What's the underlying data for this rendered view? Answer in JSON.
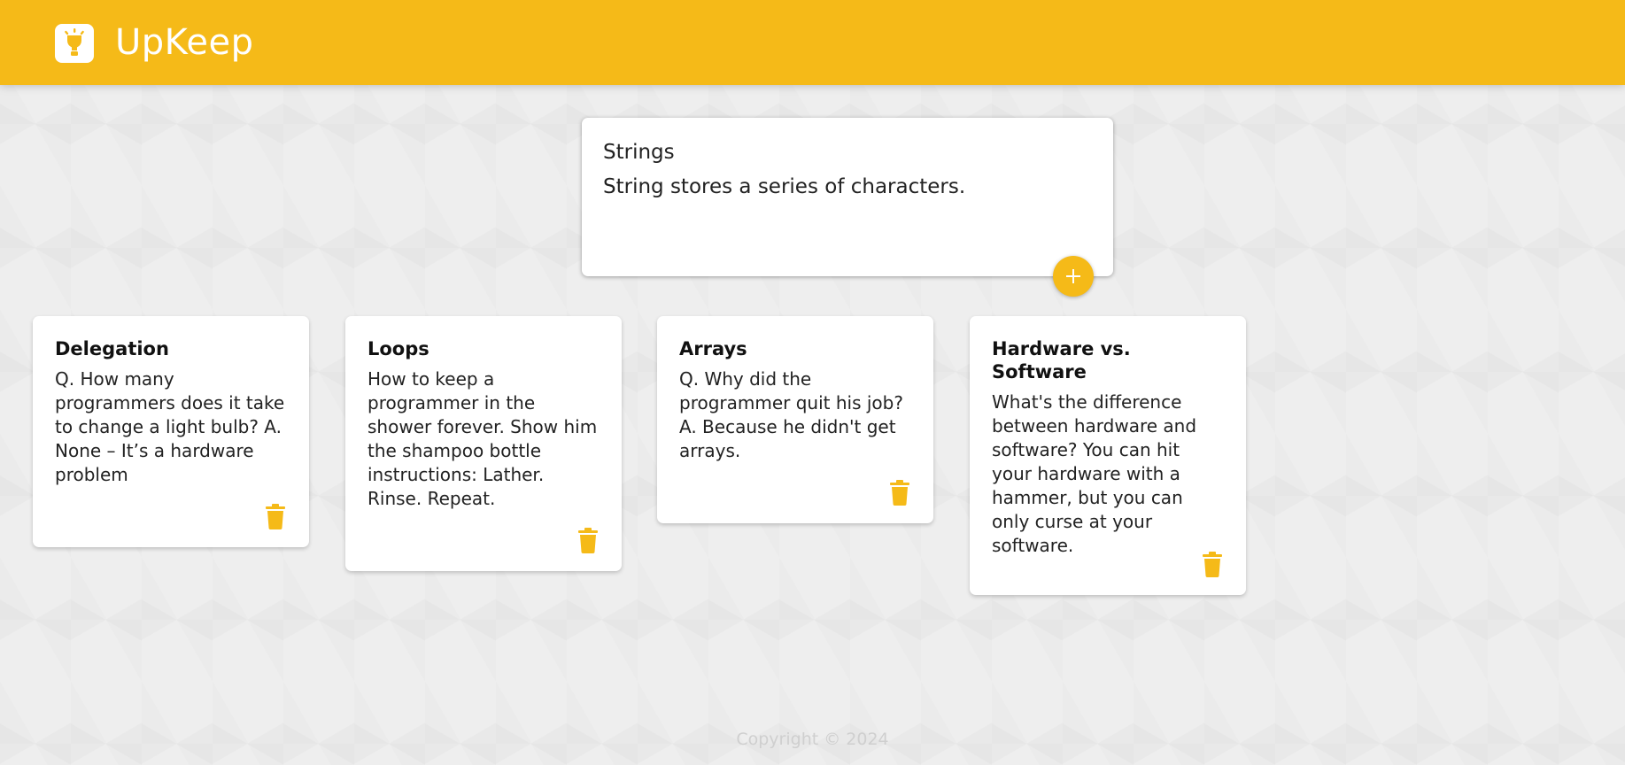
{
  "header": {
    "app_title": "UpKeep",
    "logo_icon": "lightbulb-icon",
    "accent_color": "#f5ba18"
  },
  "create_note": {
    "title_value": "Strings",
    "title_placeholder": "Title",
    "content_value": "String stores a series of characters.",
    "content_placeholder": "Take a note...",
    "add_icon": "plus-icon"
  },
  "notes": [
    {
      "title": "Delegation",
      "content": "Q. How many programmers does it take to change a light bulb? A. None – It’s a hardware problem",
      "delete_icon": "trash-icon"
    },
    {
      "title": "Loops",
      "content": "How to keep a programmer in the shower forever. Show him the shampoo bottle instructions: Lather. Rinse. Repeat.",
      "delete_icon": "trash-icon"
    },
    {
      "title": "Arrays",
      "content": "Q. Why did the programmer quit his job? A. Because he didn't get arrays.",
      "delete_icon": "trash-icon"
    },
    {
      "title": "Hardware vs. Software",
      "content": "What's the difference between hardware and software? You can hit your hardware with a hammer, but you can only curse at your software.",
      "delete_icon": "trash-icon"
    }
  ],
  "footer": {
    "copyright": "Copyright © 2024"
  }
}
